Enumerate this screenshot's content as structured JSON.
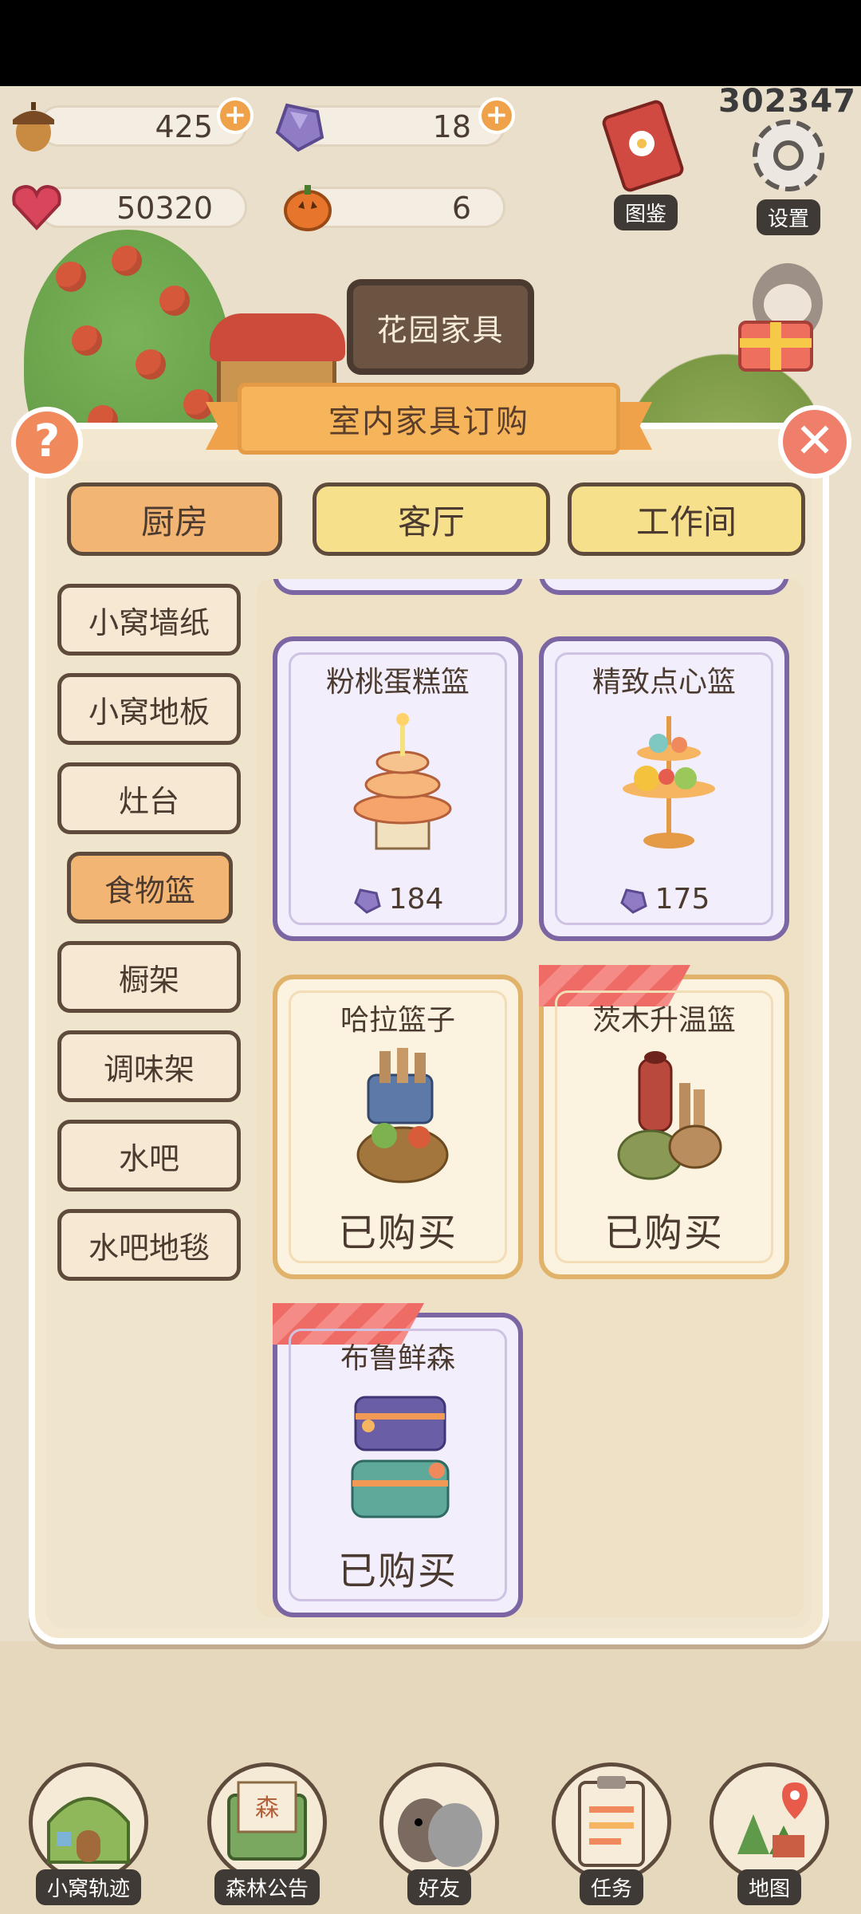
{
  "hud": {
    "score": "302347",
    "acorns": "425",
    "gems": "18",
    "hearts": "50320",
    "pumpkins": "6",
    "atlas_label": "图鉴",
    "settings_label": "设置"
  },
  "scene": {
    "sign": "花园家具"
  },
  "panel": {
    "title": "室内家具订购",
    "tabs": [
      {
        "label": "厨房",
        "active": true
      },
      {
        "label": "客厅",
        "active": false
      },
      {
        "label": "工作间",
        "active": false
      }
    ],
    "categories": [
      {
        "label": "小窝墙纸"
      },
      {
        "label": "小窝地板"
      },
      {
        "label": "灶台"
      },
      {
        "label": "食物篮",
        "active": true
      },
      {
        "label": "橱架"
      },
      {
        "label": "调味架"
      },
      {
        "label": "水吧"
      },
      {
        "label": "水吧地毯"
      }
    ],
    "items": [
      {
        "name": "粉桃蛋糕篮",
        "price": "184",
        "status": "price"
      },
      {
        "name": "精致点心篮",
        "price": "175",
        "status": "price"
      },
      {
        "name": "哈拉篮子",
        "status": "已购买"
      },
      {
        "name": "茨木升温篮",
        "status": "已购买"
      },
      {
        "name": "布鲁鲜森",
        "status": "已购买"
      }
    ]
  },
  "nav": [
    {
      "label": "小窝轨迹"
    },
    {
      "label": "森林公告"
    },
    {
      "label": "好友"
    },
    {
      "label": "任务"
    },
    {
      "label": "地图"
    }
  ],
  "colors": {
    "accent": "#f3b574",
    "tab_inactive": "#f7e08c",
    "purple_frame": "#7b66a3",
    "gold_frame": "#e1b36a",
    "close": "#ef7e6b"
  }
}
